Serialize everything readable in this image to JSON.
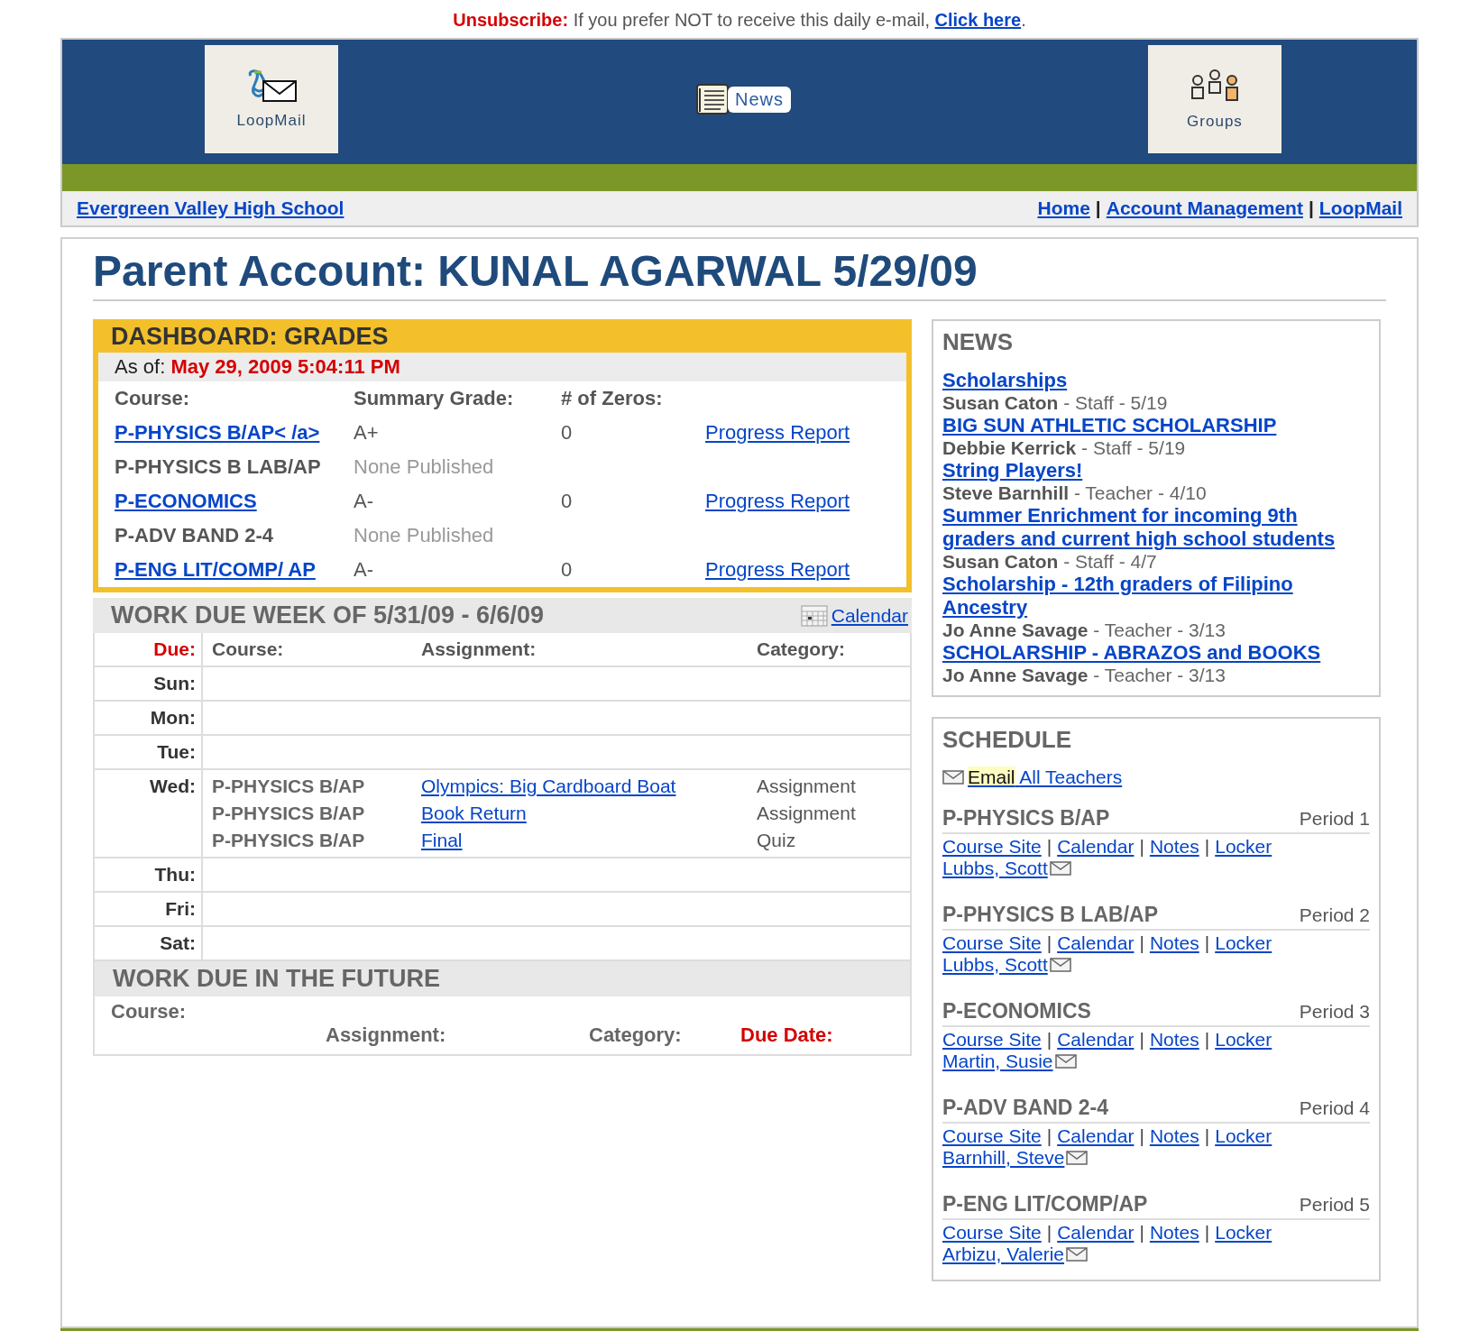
{
  "unsubscribe": {
    "label": "Unsubscribe:",
    "text": "If you prefer NOT to receive this daily e-mail,",
    "link": "Click here",
    "end": "."
  },
  "header": {
    "tiles": [
      {
        "kind": "loopmail",
        "label": "LoopMail"
      },
      {
        "kind": "news",
        "label": "News"
      },
      {
        "kind": "groups",
        "label": "Groups"
      }
    ]
  },
  "nav": {
    "school": "Evergreen Valley High School",
    "links": [
      {
        "kind": "link",
        "text": "Home"
      },
      {
        "kind": "separator",
        "text": "|"
      },
      {
        "kind": "link",
        "text": "Account Management"
      },
      {
        "kind": "separator",
        "text": "|"
      },
      {
        "kind": "link",
        "text": "LoopMail"
      }
    ]
  },
  "page_title": "Parent Account: KUNAL AGARWAL 5/29/09",
  "grades": {
    "title": "DASHBOARD: GRADES",
    "as_of_label": "As of:",
    "as_of": "May 29, 2009 5:04:11 PM",
    "columns": [
      "Course:",
      "Summary Grade:",
      "# of Zeros:"
    ],
    "rows": [
      {
        "kind": "graded",
        "course": "P-PHYSICS B/AP< /a>",
        "grade": "A+",
        "zeros": "0",
        "report": "Progress Report"
      },
      {
        "kind": "unpublished",
        "course": "P-PHYSICS B LAB/AP",
        "grade": "None Published"
      },
      {
        "kind": "graded",
        "course": "P-ECONOMICS",
        "grade": "A-",
        "zeros": "0",
        "report": "Progress Report"
      },
      {
        "kind": "unpublished",
        "course": "P-ADV BAND 2-4",
        "grade": "None Published"
      },
      {
        "kind": "graded",
        "course": "P-ENG LIT/COMP/ AP",
        "grade": "A-",
        "zeros": "0",
        "report": "Progress Report"
      }
    ]
  },
  "work_week": {
    "title": "WORK DUE WEEK OF 5/31/09 - 6/6/09",
    "calendar_link": "Calendar",
    "columns": [
      "Due:",
      "Course:",
      "Assignment:",
      "Category:"
    ],
    "days": [
      {
        "day": "Sun:"
      },
      {
        "day": "Mon:"
      },
      {
        "day": "Tue:"
      },
      {
        "day": "Wed:",
        "items": [
          {
            "course": "P-PHYSICS B/AP",
            "assignment": "Olympics: Big Cardboard Boat",
            "category": "Assignment"
          },
          {
            "course": "P-PHYSICS B/AP",
            "assignment": "Book Return",
            "category": "Assignment"
          },
          {
            "course": "P-PHYSICS B/AP",
            "assignment": "Final",
            "category": "Quiz"
          }
        ]
      },
      {
        "day": "Thu:"
      },
      {
        "day": "Fri:"
      },
      {
        "day": "Sat:"
      }
    ]
  },
  "work_future": {
    "title": "WORK DUE IN THE FUTURE",
    "columns": [
      "Course:",
      "Assignment:",
      "Category:",
      "Due Date:"
    ]
  },
  "news": {
    "title": "NEWS",
    "items": [
      {
        "title": "Scholarships",
        "byline": "**Susan Caton** - Staff - 5/19"
      },
      {
        "title": "BIG SUN ATHLETIC SCHOLARSHIP",
        "byline": "**Debbie Kerrick** - Staff - 5/19"
      },
      {
        "title": "String Players!",
        "byline": "**Steve Barnhill** - Teacher - 4/10"
      },
      {
        "title": "Summer Enrichment for incoming 9th graders and current high school students",
        "byline": "**Susan Caton** - Staff - 4/7"
      },
      {
        "title": "Scholarship - 12th graders of Filipino Ancestry",
        "byline": "**Jo Anne Savage** - Teacher - 3/13"
      },
      {
        "title": "SCHOLARSHIP - ABRAZOS and BOOKS",
        "byline": "**Jo Anne Savage** - Teacher - 3/13"
      }
    ]
  },
  "schedule": {
    "title": "SCHEDULE",
    "email_all": {
      "highlighted": "Email",
      "text": "All Teachers"
    },
    "courses": [
      {
        "name": "P-PHYSICS B/AP",
        "period": "Period 1",
        "links": [
          {
            "kind": "link",
            "text": "Course Site"
          },
          {
            "kind": "separator",
            "text": "|"
          },
          {
            "kind": "link",
            "text": "Calendar"
          },
          {
            "kind": "separator",
            "text": "|"
          },
          {
            "kind": "link",
            "text": "Notes"
          },
          {
            "kind": "separator",
            "text": "|"
          },
          {
            "kind": "link",
            "text": "Locker"
          }
        ],
        "teacher": "Lubbs, Scott"
      },
      {
        "name": "P-PHYSICS B LAB/AP",
        "period": "Period 2",
        "links": [
          {
            "kind": "link",
            "text": "Course Site"
          },
          {
            "kind": "separator",
            "text": "|"
          },
          {
            "kind": "link",
            "text": "Calendar"
          },
          {
            "kind": "separator",
            "text": "|"
          },
          {
            "kind": "link",
            "text": "Notes"
          },
          {
            "kind": "separator",
            "text": "|"
          },
          {
            "kind": "link",
            "text": "Locker"
          }
        ],
        "teacher": "Lubbs, Scott"
      },
      {
        "name": "P-ECONOMICS",
        "period": "Period 3",
        "links": [
          {
            "kind": "link",
            "text": "Course Site"
          },
          {
            "kind": "separator",
            "text": "|"
          },
          {
            "kind": "link",
            "text": "Calendar"
          },
          {
            "kind": "separator",
            "text": "|"
          },
          {
            "kind": "link",
            "text": "Notes"
          },
          {
            "kind": "separator",
            "text": "|"
          },
          {
            "kind": "link",
            "text": "Locker"
          }
        ],
        "teacher": "Martin, Susie"
      },
      {
        "name": "P-ADV BAND 2-4",
        "period": "Period 4",
        "links": [
          {
            "kind": "link",
            "text": "Course Site"
          },
          {
            "kind": "separator",
            "text": "|"
          },
          {
            "kind": "link",
            "text": "Calendar"
          },
          {
            "kind": "separator",
            "text": "|"
          },
          {
            "kind": "link",
            "text": "Notes"
          },
          {
            "kind": "separator",
            "text": "|"
          },
          {
            "kind": "link",
            "text": "Locker"
          }
        ],
        "teacher": "Barnhill, Steve"
      },
      {
        "name": "P-ENG LIT/COMP/AP",
        "period": "Period 5",
        "links": [
          {
            "kind": "link",
            "text": "Course Site"
          },
          {
            "kind": "separator",
            "text": "|"
          },
          {
            "kind": "link",
            "text": "Calendar"
          },
          {
            "kind": "separator",
            "text": "|"
          },
          {
            "kind": "link",
            "text": "Notes"
          },
          {
            "kind": "separator",
            "text": "|"
          },
          {
            "kind": "link",
            "text": "Locker"
          }
        ],
        "teacher": "Arbizu, Valerie"
      }
    ]
  }
}
